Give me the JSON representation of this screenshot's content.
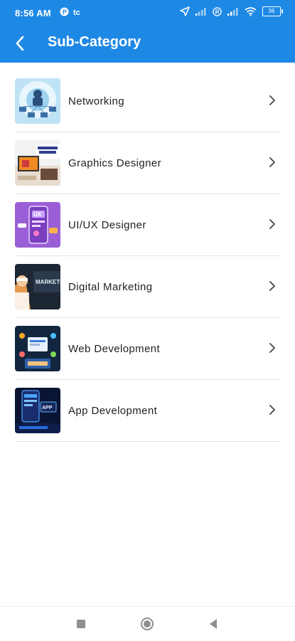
{
  "status_bar": {
    "time": "8:56 AM",
    "battery": "36"
  },
  "header": {
    "title": "Sub-Category",
    "back_icon": "chevron-left-icon",
    "background_color": "#1e88e5"
  },
  "list": {
    "items": [
      {
        "label": "Networking",
        "thumbnail": "networking-image"
      },
      {
        "label": "Graphics Designer",
        "thumbnail": "graphics-designer-image"
      },
      {
        "label": "UI/UX Designer",
        "thumbnail": "ui-ux-designer-image"
      },
      {
        "label": "Digital Marketing",
        "thumbnail": "digital-marketing-image"
      },
      {
        "label": "Web Development",
        "thumbnail": "web-development-image"
      },
      {
        "label": "App Development",
        "thumbnail": "app-development-image"
      }
    ]
  },
  "nav_bar": {
    "buttons": [
      "recent-apps-icon",
      "home-icon",
      "back-triangle-icon"
    ]
  }
}
